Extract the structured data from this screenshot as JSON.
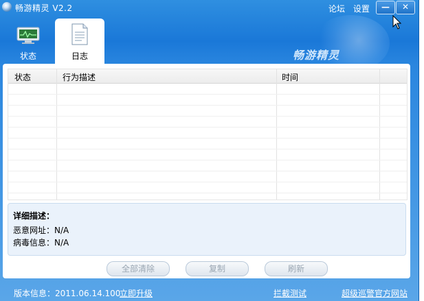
{
  "window": {
    "title": "畅游精灵 V2.2",
    "links": [
      "论坛",
      "设置"
    ],
    "minimize_glyph": "—",
    "close_glyph": "✕"
  },
  "tabs": [
    {
      "label": "状态",
      "icon": "monitor-icon",
      "active": false
    },
    {
      "label": "日志",
      "icon": "document-icon",
      "active": true
    }
  ],
  "brand_text": "畅游精灵",
  "table": {
    "columns": [
      "状态",
      "行为描述",
      "时间"
    ],
    "rows": []
  },
  "detail": {
    "title": "详细描述：",
    "malicious_url_label": "恶意网址：N/A",
    "virus_info_label": "病毒信息：N/A"
  },
  "buttons": {
    "clear_all": "全部清除",
    "copy": "复制",
    "refresh": "刷新"
  },
  "status_bar": {
    "version": "版本信息：2011.06.14.100",
    "upgrade": "立即升级",
    "intercept_test": "拦截测试",
    "official_site": "超级巡警官方网站"
  },
  "colors": {
    "window_blue": "#1a78d8",
    "panel_bg": "#ffffff",
    "detail_bg": "#eaf2fb"
  }
}
